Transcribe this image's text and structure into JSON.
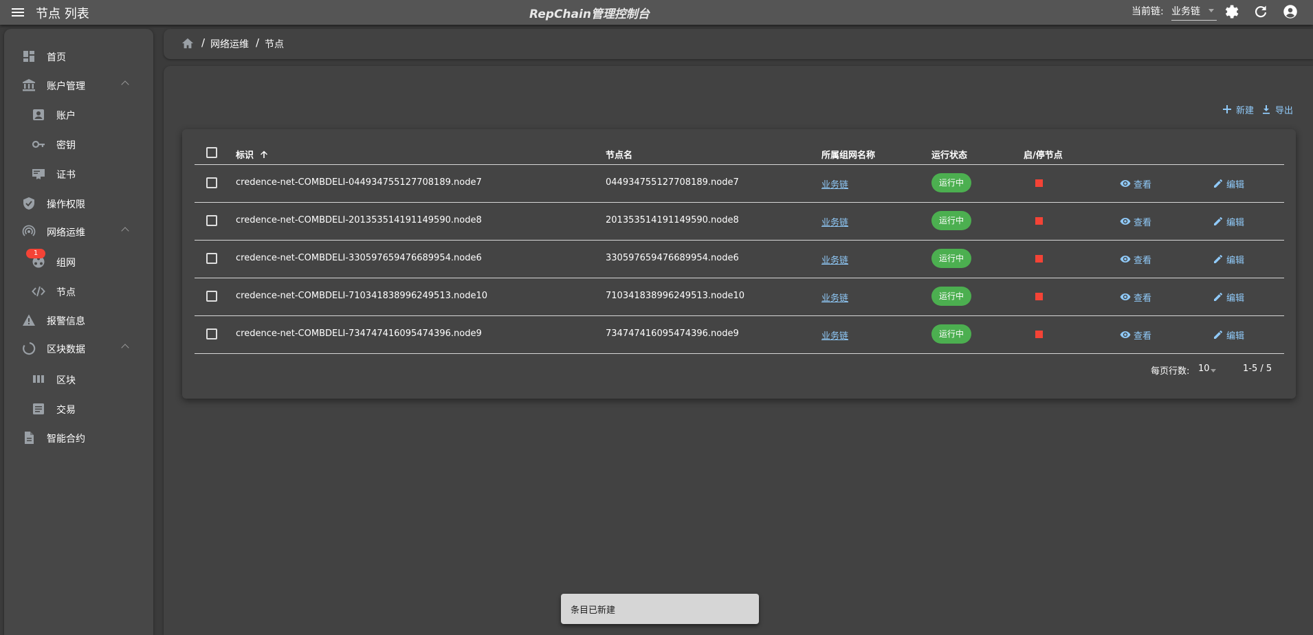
{
  "appbar": {
    "page_title": "节点 列表",
    "app_title": "RepChain管理控制台",
    "chain_label": "当前链:",
    "chain_value": "业务链",
    "icons": [
      "menu-icon",
      "settings-icon",
      "refresh-icon",
      "account-icon"
    ]
  },
  "sidebar": {
    "items": [
      {
        "label": "首页",
        "icon": "dashboard-icon"
      },
      {
        "label": "账户管理",
        "icon": "bank-icon"
      },
      {
        "label": "账户",
        "icon": "account-box-icon"
      },
      {
        "label": "密钥",
        "icon": "key-icon"
      },
      {
        "label": "证书",
        "icon": "certificate-icon"
      },
      {
        "label": "操作权限",
        "icon": "shield-check-icon"
      },
      {
        "label": "网络运维",
        "icon": "broadcast-icon"
      },
      {
        "label": "组网",
        "icon": "network-icon"
      },
      {
        "label": "节点",
        "icon": "node-icon"
      },
      {
        "label": "报警信息",
        "icon": "alert-icon"
      },
      {
        "label": "区块数据",
        "icon": "progress-icon"
      },
      {
        "label": "区块",
        "icon": "blocks-icon"
      },
      {
        "label": "交易",
        "icon": "list-icon"
      },
      {
        "label": "智能合约",
        "icon": "file-document-icon"
      }
    ],
    "node_badge": "1"
  },
  "breadcrumb": {
    "items": [
      "网络运维",
      "节点"
    ],
    "separator": "/"
  },
  "toolbar": {
    "new_label": "新建",
    "export_label": "导出"
  },
  "table": {
    "headers": {
      "id": "标识",
      "name": "节点名",
      "network": "所属组网名称",
      "status": "运行状态",
      "toggle": "启/停节点"
    },
    "rows": [
      {
        "id": "credence-net-COMBDELI-044934755127708189.node7",
        "name": "044934755127708189.node7",
        "network": "业务链",
        "status": "运行中",
        "view": "查看",
        "edit": "编辑"
      },
      {
        "id": "credence-net-COMBDELI-201353514191149590.node8",
        "name": "201353514191149590.node8",
        "network": "业务链",
        "status": "运行中",
        "view": "查看",
        "edit": "编辑"
      },
      {
        "id": "credence-net-COMBDELI-330597659476689954.node6",
        "name": "330597659476689954.node6",
        "network": "业务链",
        "status": "运行中",
        "view": "查看",
        "edit": "编辑"
      },
      {
        "id": "credence-net-COMBDELI-710341838996249513.node10",
        "name": "710341838996249513.node10",
        "network": "业务链",
        "status": "运行中",
        "view": "查看",
        "edit": "编辑"
      },
      {
        "id": "credence-net-COMBDELI-734747416095474396.node9",
        "name": "734747416095474396.node9",
        "network": "业务链",
        "status": "运行中",
        "view": "查看",
        "edit": "编辑"
      }
    ],
    "footer": {
      "rows_per_page_label": "每页行数:",
      "rows_per_page_value": "10",
      "range": "1-5 / 5"
    }
  },
  "snackbar": {
    "message": "条目已新建"
  },
  "colors": {
    "accent": "#90caf9",
    "running": "#4caf50",
    "stop": "#f44336"
  }
}
